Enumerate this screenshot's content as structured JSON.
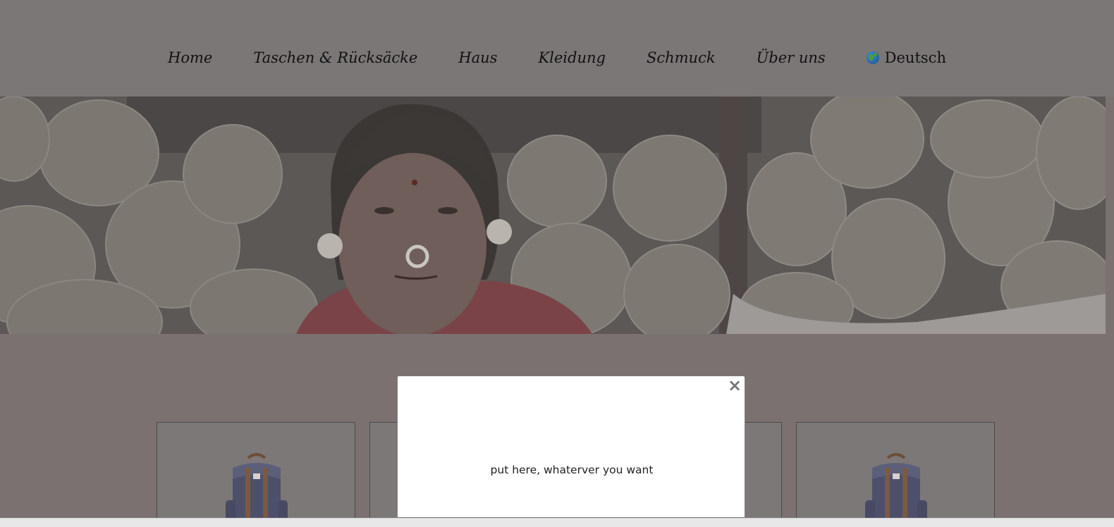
{
  "nav": {
    "items": [
      "Home",
      "Taschen & Rücksäcke",
      "Haus",
      "Kleidung",
      "Schmuck",
      "Über uns"
    ],
    "language": "Deutsch",
    "language_icon": "globe-icon"
  },
  "hero": {
    "image": "woman-with-yarn-balls"
  },
  "products": [
    {
      "image": "backpack"
    },
    {
      "image": "backpack"
    },
    {
      "image": "backpack"
    },
    {
      "image": "backpack"
    }
  ],
  "modal": {
    "close_label": "×",
    "text": "put here, whaterver you want"
  },
  "colors": {
    "overlay": "#7a7170",
    "nav_background": "#7b7776",
    "modal_background": "#ffffff"
  }
}
